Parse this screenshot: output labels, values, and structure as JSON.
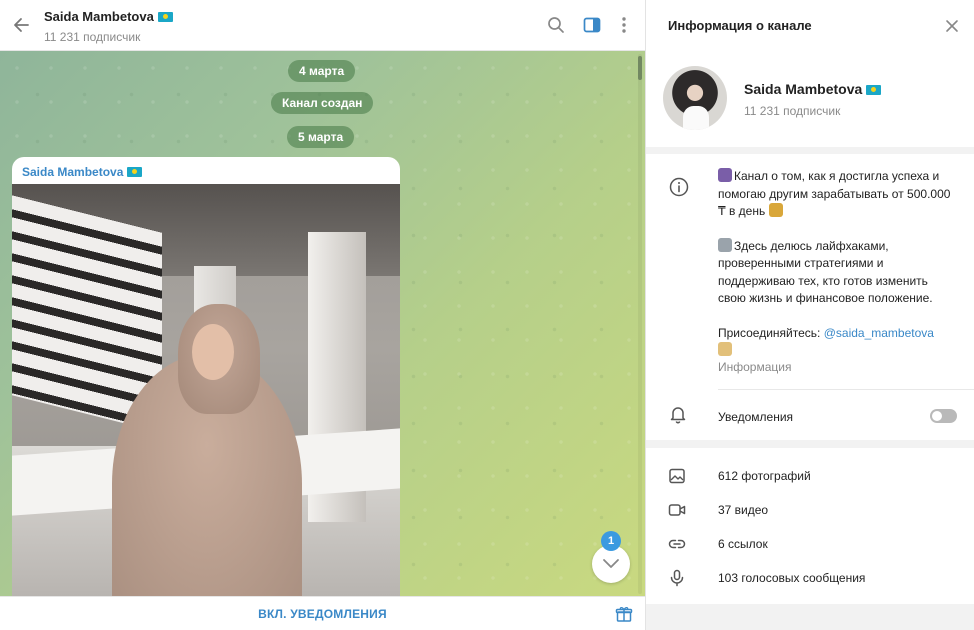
{
  "chat": {
    "title": "Saida Mambetova",
    "subtitle": "11 231 подписчик",
    "service_messages": [
      "4 марта",
      "Канал создан",
      "5 марта"
    ],
    "post_author": "Saida Mambetova",
    "unread_count": "1",
    "footer_button": "ВКЛ. УВЕДОМЛЕНИЯ"
  },
  "info": {
    "header_title": "Информация о канале",
    "name": "Saida Mambetova",
    "subscribers": "11 231 подписчик",
    "about": {
      "p1": "Канал о том, как я достигла успеха и помогаю другим зарабатывать от 500.000 ₸ в день",
      "p2": "Здесь делюсь лайфхаками, проверенными стратегиями и поддерживаю тех, кто готов изменить свою жизнь и финансовое положение.",
      "p3_prefix": "Присоединяйтесь: ",
      "p3_link": "@saida_mambetova",
      "label": "Информация"
    },
    "notifications_label": "Уведомления",
    "notifications_enabled": false,
    "media": [
      {
        "icon": "photo-icon",
        "label": "612 фотографий"
      },
      {
        "icon": "video-icon",
        "label": "37 видео"
      },
      {
        "icon": "link-icon",
        "label": "6 ссылок"
      },
      {
        "icon": "microphone-icon",
        "label": "103 голосовых сообщения"
      }
    ]
  },
  "colors": {
    "accent": "#3a88c7",
    "badge": "#3b9ae0",
    "flag": "#1ba7c7"
  }
}
